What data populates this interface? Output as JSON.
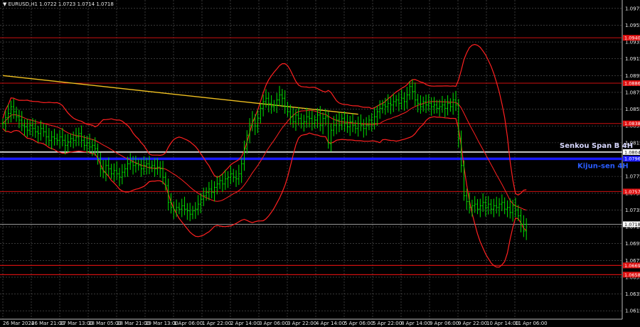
{
  "header": {
    "arrow": "▼",
    "text": "EURUSD,H1  1.0722 1.0723 1.0714 1.0718"
  },
  "colors": {
    "background": "#000000",
    "grid": "#5a5a5a",
    "candle": "#00e000",
    "bands": "#ff2020",
    "resistance": "#cc1010",
    "trendline": "#f0c020",
    "senkou": "#ffffff",
    "kijun": "#1a1aff",
    "kijun_text": "#2a5cff",
    "senkou_text": "#d8d8ff",
    "label_bg": "#e01010"
  },
  "chart_data": {
    "type": "candlestick",
    "symbol": "EURUSD",
    "timeframe": "H1",
    "ylim": [
      1.0605,
      1.0985
    ],
    "y_ticks": [
      "1.0975",
      "1.0955",
      "1.0935",
      "1.0915",
      "1.0895",
      "1.0875",
      "1.0855",
      "1.0835",
      "1.0815",
      "1.0795",
      "1.0775",
      "1.0755",
      "1.0735",
      "1.0715",
      "1.0695",
      "1.0675",
      "1.0655",
      "1.0635",
      "1.0615"
    ],
    "x_ticks": [
      "26 Mar 2024",
      "26 Mar 21:00",
      "27 Mar 13:00",
      "28 Mar 05:00",
      "28 Mar 21:00",
      "29 Mar 13:00",
      "1 Apr 06:00",
      "1 Apr 22:00",
      "2 Apr 14:00",
      "3 Apr 06:00",
      "3 Apr 22:00",
      "4 Apr 14:00",
      "5 Apr 06:00",
      "5 Apr 22:00",
      "8 Apr 14:00",
      "9 Apr 06:00",
      "9 Apr 22:00",
      "10 Apr 14:00",
      "11 Apr 06:00"
    ],
    "levels": [
      {
        "name": "resistance",
        "value": 1.094,
        "label": "1.0940"
      },
      {
        "name": "resistance",
        "value": 1.0886,
        "label": "1.0886"
      },
      {
        "name": "resistance",
        "value": 1.0838,
        "label": "1.0838"
      },
      {
        "name": "senkou_span_b",
        "value": 1.0804,
        "label": "1.0804"
      },
      {
        "name": "kijun_sen",
        "value": 1.0796,
        "label": "1.0796"
      },
      {
        "name": "resistance",
        "value": 1.0757,
        "label": "1.0757"
      },
      {
        "name": "current",
        "value": 1.0718,
        "label": "1.0718"
      },
      {
        "name": "support",
        "value": 1.0669,
        "label": "1.0669"
      },
      {
        "name": "support",
        "value": 1.0658,
        "label": "1.0658"
      }
    ],
    "annotations": [
      {
        "name": "senkou",
        "text": "Senkou Span B 4H"
      },
      {
        "name": "kijun",
        "text": "Kijun-sen 4H"
      }
    ],
    "trendline": {
      "from": [
        0,
        1.0895
      ],
      "to": [
        131,
        1.0849
      ]
    },
    "ohlc_close": [
      1.0838,
      1.0845,
      1.085,
      1.0858,
      1.0852,
      1.0846,
      1.0842,
      1.0836,
      1.0834,
      1.083,
      1.0836,
      1.0832,
      1.0828,
      1.0826,
      1.0832,
      1.0828,
      1.0822,
      1.0818,
      1.0822,
      1.082,
      1.0818,
      1.0822,
      1.0818,
      1.0812,
      1.0816,
      1.082,
      1.0818,
      1.0822,
      1.0826,
      1.0818,
      1.0812,
      1.0815,
      1.081,
      1.0812,
      1.0808,
      1.0795,
      1.0784,
      1.078,
      1.0788,
      1.0784,
      1.0778,
      1.0782,
      1.0778,
      1.0774,
      1.078,
      1.0784,
      1.079,
      1.0792,
      1.0788,
      1.079,
      1.0788,
      1.0784,
      1.0788,
      1.079,
      1.0786,
      1.0788,
      1.0784,
      1.0786,
      1.0784,
      1.0774,
      1.0764,
      1.0744,
      1.0738,
      1.0735,
      1.0738,
      1.0736,
      1.074,
      1.0736,
      1.0734,
      1.073,
      1.0734,
      1.0736,
      1.0742,
      1.0748,
      1.0752,
      1.0756,
      1.076,
      1.0756,
      1.0762,
      1.0766,
      1.077,
      1.0766,
      1.0772,
      1.0774,
      1.0778,
      1.0774,
      1.0772,
      1.0778,
      1.079,
      1.0808,
      1.0824,
      1.0836,
      1.0842,
      1.0835,
      1.0844,
      1.0856,
      1.0864,
      1.0868,
      1.0862,
      1.0858,
      1.086,
      1.0866,
      1.0872,
      1.0868,
      1.0858,
      1.0852,
      1.0846,
      1.084,
      1.0848,
      1.0844,
      1.0838,
      1.084,
      1.0846,
      1.0844,
      1.0838,
      1.0842,
      1.0848,
      1.0836,
      1.0844,
      1.0846,
      1.0814,
      1.083,
      1.0836,
      1.0842,
      1.0836,
      1.0844,
      1.0838,
      1.0834,
      1.084,
      1.0836,
      1.0832,
      1.0838,
      1.0836,
      1.0832,
      1.0836,
      1.0842,
      1.0838,
      1.0846,
      1.0852,
      1.0856,
      1.086,
      1.0858,
      1.0862,
      1.086,
      1.0864,
      1.0866,
      1.0862,
      1.0868,
      1.0864,
      1.0872,
      1.0882,
      1.0876,
      1.0866,
      1.0862,
      1.0858,
      1.0864,
      1.086,
      1.0862,
      1.0858,
      1.086,
      1.0856,
      1.0858,
      1.086,
      1.0856,
      1.0862,
      1.0858,
      1.0866,
      1.086,
      1.082,
      1.0788,
      1.0752,
      1.0745,
      1.0738,
      1.074,
      1.0742,
      1.0736,
      1.074,
      1.0744,
      1.0738,
      1.0742,
      1.0736,
      1.074,
      1.0738,
      1.0742,
      1.0744,
      1.0736,
      1.0738,
      1.0732,
      1.074,
      1.0735,
      1.0728,
      1.0718,
      1.071,
      1.0718
    ]
  }
}
